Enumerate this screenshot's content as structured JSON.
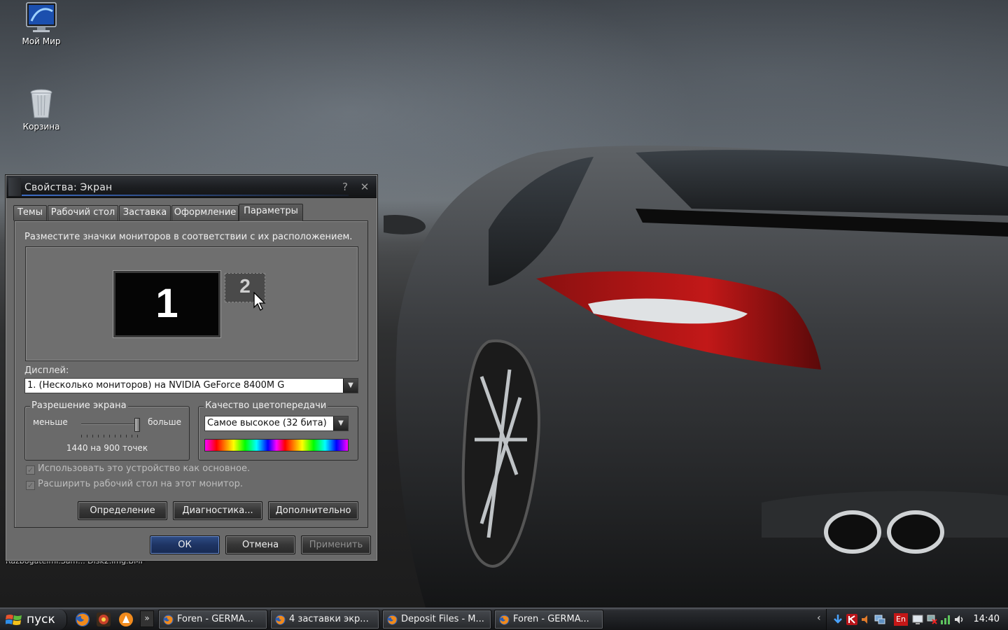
{
  "desktop": {
    "icons": [
      {
        "label": "Мой Мир"
      },
      {
        "label": "Корзина"
      }
    ],
    "hidden_text": "Razbogatelmi.Sam...     Disk2.img.BMP"
  },
  "dialog": {
    "title": "Свойства: Экран",
    "help_glyph": "?",
    "close_glyph": "✕",
    "tabs": [
      {
        "label": "Темы"
      },
      {
        "label": "Рабочий стол"
      },
      {
        "label": "Заставка"
      },
      {
        "label": "Оформление"
      },
      {
        "label": "Параметры",
        "active": true
      }
    ],
    "instruction": "Разместите значки мониторов в соответствии с их расположением.",
    "monitors": [
      {
        "number": "1"
      },
      {
        "number": "2"
      }
    ],
    "display_label": "Дисплей:",
    "display_value": "1. (Несколько мониторов) на NVIDIA GeForce 8400M G",
    "resolution": {
      "title": "Разрешение экрана",
      "less": "меньше",
      "more": "больше",
      "value": "1440 на 900 точек",
      "slider_level": 1.0
    },
    "color_quality": {
      "title": "Качество цветопередачи",
      "value": "Самое высокое (32 бита)"
    },
    "checkboxes": [
      {
        "label": "Использовать это устройство как основное.",
        "checked": true,
        "enabled": false
      },
      {
        "label": "Расширить рабочий стол на этот монитор.",
        "checked": true,
        "enabled": false
      }
    ],
    "buttons": {
      "identify": "Определение",
      "diagnostics": "Диагностика...",
      "advanced": "Дополнительно",
      "ok": "ОК",
      "cancel": "Отмена",
      "apply": "Применить"
    }
  },
  "taskbar": {
    "start_label": "пуск",
    "more_glyph": "»",
    "tasks": [
      {
        "label": "Foren - GERMA..."
      },
      {
        "label": "4 заставки экр..."
      },
      {
        "label": "Deposit Files - M..."
      },
      {
        "label": "Foren - GERMA..."
      }
    ],
    "tray": {
      "chevron": "‹",
      "language": "En",
      "clock": "14:40"
    }
  },
  "colors": {
    "accent_blue": "#3d6cc6",
    "ok_button": "#1e3463",
    "dialog_bg": "#6a6a6a",
    "taskbar_bg": "#1d1f22"
  }
}
